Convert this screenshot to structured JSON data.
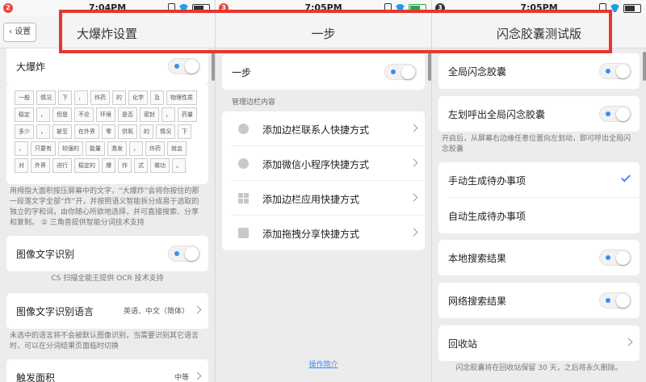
{
  "panel1": {
    "status_time": "7:04PM",
    "notif_count": "2",
    "back_label": "设置",
    "title": "大爆炸设置",
    "bigbang_label": "大爆炸",
    "tokens": [
      "一般",
      "情况",
      "下",
      "，",
      "炸药",
      "的",
      "化学",
      "及",
      "物理性质",
      "稳定",
      "，",
      "但是",
      "不论",
      "环境",
      "是否",
      "密封",
      "，",
      "药量",
      "多少",
      "，",
      "甚至",
      "在外界",
      "零",
      "供氧",
      "的",
      "情况",
      "下",
      "，",
      "只要有",
      "较强的",
      "能量",
      "激发",
      "，",
      "炸药",
      "就会",
      "对",
      "外界",
      "进行",
      "稳定的",
      "爆",
      "炸",
      "式",
      "做功",
      "。"
    ],
    "bigbang_note": "用拇指大面积按压屏幕中的文字，“大爆炸”会将你按住的那一段落文字全部“炸”开，并按照语义智能拆分成易于选取的独立的字和词，由你随心所欲地选择，并可直接搜索、分享和复制。 ② 三角兽提供智能分词技术支持",
    "ocr_label": "图像文字识别",
    "ocr_note": "CS 扫描全能王提供 OCR 技术支持",
    "ocr_lang_label": "图像文字识别语言",
    "ocr_lang_value": "英语、中文（简体）",
    "ocr_lang_note": "未选中的语言将不会被默认图像识别，当需要识别其它语言时，可以在分词结果页面临时切换",
    "area_label": "触发面积",
    "area_value": "中等"
  },
  "panel2": {
    "status_time": "7:05PM",
    "notif_count": "3",
    "title": "一步",
    "onestep_label": "一步",
    "section_label": "管理边栏内容",
    "items": [
      {
        "label": "添加边栏联系人快捷方式",
        "icon": "person-icon"
      },
      {
        "label": "添加微信小程序快捷方式",
        "icon": "mini-program-icon"
      },
      {
        "label": "添加边栏应用快捷方式",
        "icon": "grid-icon"
      },
      {
        "label": "添加拖拽分享快捷方式",
        "icon": "share-icon"
      }
    ],
    "link_label": "操作简介"
  },
  "panel3": {
    "status_time": "7:05PM",
    "notif_count": "3",
    "title": "闪念胶囊测试版",
    "global_label": "全局闪念胶囊",
    "swipe_label": "左划呼出全局闪念胶囊",
    "swipe_note": "开启后，从屏幕右边缘任意位置向左划动，即可呼出全局闪念胶囊",
    "manual_label": "手动生成待办事项",
    "auto_label": "自动生成待办事项",
    "local_label": "本地搜索结果",
    "web_label": "网络搜索结果",
    "bin_label": "回收站",
    "bin_note": "闪念胶囊将在回收站保留 30 天，之后将永久删除。"
  },
  "colors": {
    "accent": "#3f8cf5",
    "highlight": "#e8362d"
  }
}
